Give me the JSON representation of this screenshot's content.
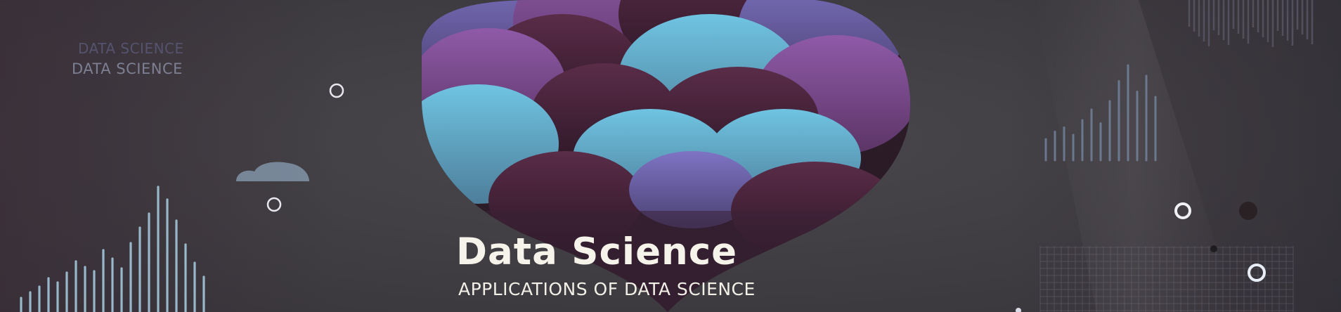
{
  "banner": {
    "background_color": "#3d3b3e",
    "watermark_lines": [
      "DATA SCIENCE",
      "DATA SCIENCE"
    ],
    "title": "Data Science",
    "subtitle": "APPLICATIONS OF DATA SCIENCE"
  },
  "palette": {
    "accent_blue": "#6fb9d8",
    "accent_purple": "#7a4c8c",
    "deep_plum": "#3f2134",
    "text_light": "#f6f4ea"
  },
  "icons": [
    "ring-icon",
    "dot-icon",
    "cloud-icon",
    "waveform-icon",
    "bar-chart-icon",
    "grid-icon"
  ]
}
